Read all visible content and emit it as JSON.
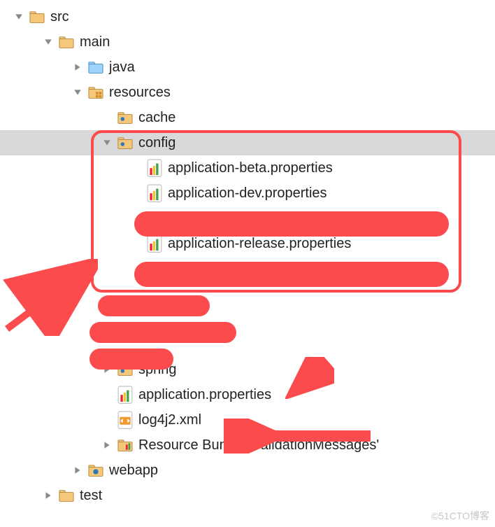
{
  "tree": {
    "src": "src",
    "main": "main",
    "java": "java",
    "resources": "resources",
    "cache": "cache",
    "config": "config",
    "app_beta": "application-beta.properties",
    "app_dev": "application-dev.properties",
    "app_release": "application-release.properties",
    "spring": "spring",
    "app_props": "application.properties",
    "log4j2": "log4j2.xml",
    "resource_bundle": "Resource Bundle 'ValidationMessages'",
    "webapp": "webapp",
    "test": "test"
  },
  "watermark": "©51CTO博客"
}
